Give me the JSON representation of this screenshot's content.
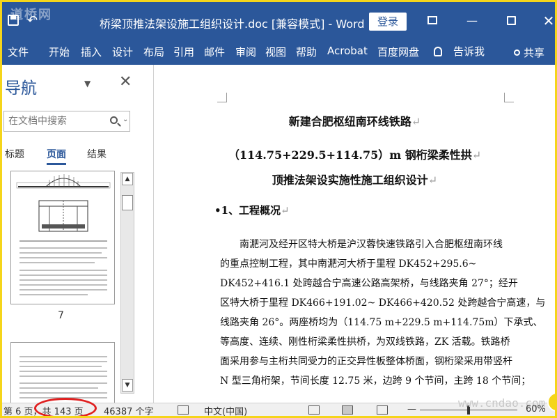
{
  "titlebar": {
    "watermark": "道桥网",
    "watermark_small": "www.cndao.com",
    "document_title": "桥梁顶推法架设施工组织设计.doc [兼容模式]  -  Word",
    "login_label": "登录",
    "close_glyph": "✕",
    "minimize_glyph": "—"
  },
  "ribbon": {
    "tabs": [
      "文件",
      "开始",
      "插入",
      "设计",
      "布局",
      "引用",
      "邮件",
      "审阅",
      "视图",
      "帮助",
      "Acrobat",
      "百度网盘"
    ],
    "tell_me": "告诉我",
    "share": "共享"
  },
  "nav": {
    "title": "导航",
    "search_placeholder": "在文档中搜索",
    "tabs": [
      "标题",
      "页面",
      "结果"
    ],
    "active_tab": "页面",
    "thumb_page_label": "7"
  },
  "document": {
    "heading1": "新建合肥枢纽南环线铁路",
    "heading2": "（114.75+229.5+114.75）m 钢桁梁柔性拱",
    "heading3": "顶推法架设实施性施工组织设计",
    "section1": "1、工程概况",
    "para_lines": [
      "南淝河及经开区特大桥是沪汉蓉快速铁路引入合肥枢纽南环线",
      "的重点控制工程，其中南淝河大桥于里程 DK452+295.6~",
      "DK452+416.1 处跨越合宁高速公路高架桥，与线路夹角 27°；经开",
      "区特大桥于里程 DK466+191.02~ DK466+420.52 处跨越合宁高速，与",
      "线路夹角 26°。两座桥均为（114.75 m+229.5 m+114.75m）下承式、",
      "等高度、连续、刚性桁梁柔性拱桥，为双线铁路，ZK 活载。铁路桥",
      "面采用参与主桁共同受力的正交异性板整体桥面，钢桁梁采用带竖杆",
      "N 型三角桁架，节间长度 12.75 米，边跨 9 个节间，主跨 18 个节间；"
    ],
    "para_mark": "↵"
  },
  "statusbar": {
    "page_info": "第 6 页，共 143 页",
    "word_count": "46387 个字",
    "language": "中文(中国)",
    "zoom": "60%",
    "annotation_color": "#e02020"
  },
  "colors": {
    "accent": "#2b579a",
    "frame": "#f5d51a"
  }
}
